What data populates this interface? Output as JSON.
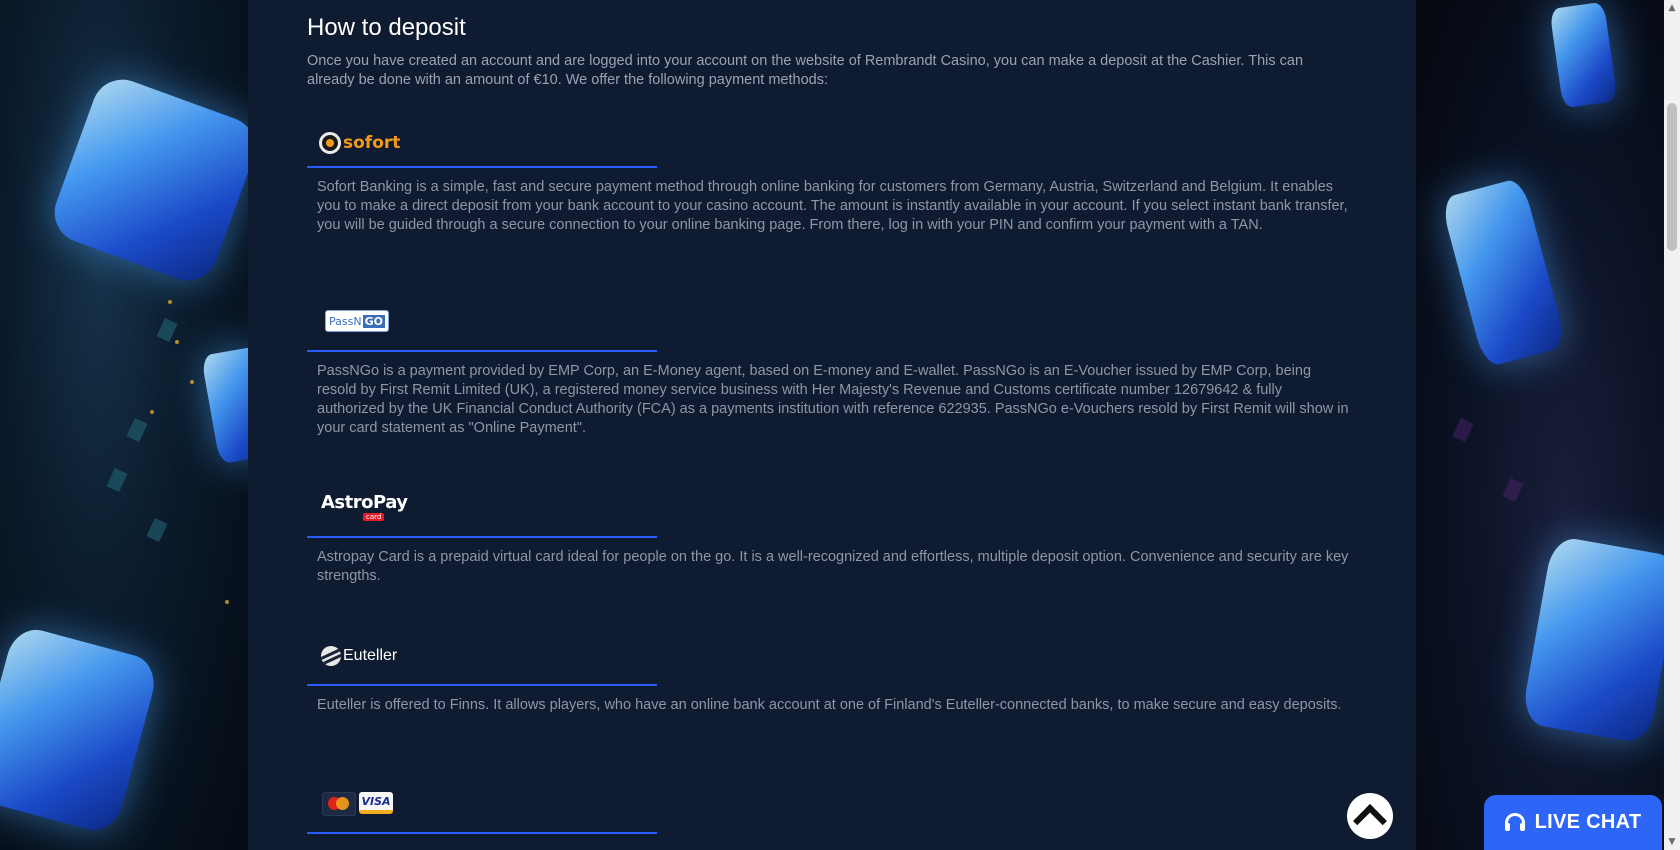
{
  "section": {
    "title": "How to deposit",
    "intro": "Once you have created an account and are logged into your account on the website of Rembrandt Casino, you can make a deposit at the Cashier. This can already be done with an amount of €10. We offer the following payment methods:"
  },
  "methods": [
    {
      "logo_icon": "sofort-logo",
      "logo_text": "sofort",
      "description": "Sofort Banking is a simple, fast and secure payment method through online banking for customers from Germany, Austria, Switzerland and Belgium. It enables you to make a direct deposit from your bank account to your casino account. The amount is instantly available in your account. If you select instant bank transfer, you will be guided through a secure connection to your online banking page. From there, log in with your PIN and confirm your payment with a TAN."
    },
    {
      "logo_icon": "passngo-logo",
      "logo_text_a": "PassN",
      "logo_text_b": "GO",
      "description": "PassNGo is a payment provided by EMP Corp, an E-Money agent, based on E-money and E-wallet. PassNGo is an E-Voucher issued by EMP Corp, being resold by First Remit Limited (UK), a registered money service business with Her Majesty's Revenue and Customs certificate number 12679642 & fully authorized by the UK Financial Conduct Authority (FCA) as a payments institution with reference 622935. PassNGo e-Vouchers resold by First Remit will show in your card statement as \"Online Payment\"."
    },
    {
      "logo_icon": "astropay-logo",
      "logo_text": "AstroPay",
      "logo_sub": "card",
      "description": "Astropay Card is a prepaid virtual card ideal for people on the go. It is a well-recognized and effortless, multiple deposit option. Convenience and security are key strengths."
    },
    {
      "logo_icon": "euteller-logo",
      "logo_text": "Euteller",
      "description": "Euteller is offered to Finns. It allows players, who have an online bank account at one of Finland's Euteller-connected banks, to make secure and easy deposits."
    },
    {
      "logo_icon": "mastercard-visa-logo",
      "logo_text": "VISA"
    }
  ],
  "widgets": {
    "back_to_top_icon": "chevron-up-icon",
    "live_chat_label": "LIVE CHAT",
    "live_chat_icon": "headset-icon"
  },
  "colors": {
    "accent": "#2e5cff",
    "live_chat": "#2d66f6",
    "content_bg": "#0f1b30",
    "text": "#8e97a6"
  }
}
